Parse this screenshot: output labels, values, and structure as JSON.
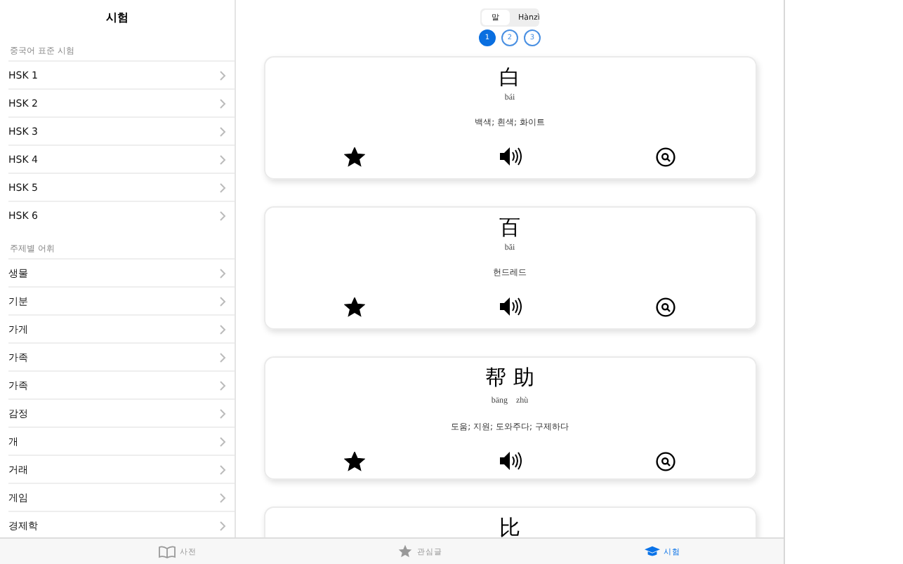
{
  "sidebar": {
    "title": "시험",
    "sections": [
      {
        "header": "중국어 표준 시험",
        "items": [
          {
            "label": "HSK 1"
          },
          {
            "label": "HSK 2"
          },
          {
            "label": "HSK 3"
          },
          {
            "label": "HSK 4"
          },
          {
            "label": "HSK 5"
          },
          {
            "label": "HSK 6"
          }
        ]
      },
      {
        "header": "주제별 어휘",
        "items": [
          {
            "label": "생물"
          },
          {
            "label": "기분"
          },
          {
            "label": "가게"
          },
          {
            "label": "가족"
          },
          {
            "label": "가족"
          },
          {
            "label": "감정"
          },
          {
            "label": "개"
          },
          {
            "label": "거래"
          },
          {
            "label": "게임"
          },
          {
            "label": "경제학"
          }
        ]
      }
    ]
  },
  "segmented": [
    {
      "label": "말",
      "selected": true
    },
    {
      "label": "Hànzì",
      "selected": false
    }
  ],
  "pages": [
    {
      "label": "1",
      "selected": true
    },
    {
      "label": "2",
      "selected": false
    },
    {
      "label": "3",
      "selected": false
    }
  ],
  "cards": [
    {
      "hanzi": "白",
      "pinyin": "bái",
      "meaning": "백색; 흰색; 화이트",
      "starred": true
    },
    {
      "hanzi": "百",
      "pinyin": "bǎi",
      "meaning": "헌드레드",
      "starred": true
    },
    {
      "hanzi": "帮 助",
      "pinyin": "bāng　zhù",
      "meaning": "도움; 지원; 도와주다; 구제하다",
      "starred": true
    },
    {
      "hanzi": "比"
    }
  ],
  "tab_bar": [
    {
      "label": "사전",
      "kind": "book",
      "selected": false
    },
    {
      "label": "관심글",
      "kind": "star",
      "selected": false
    },
    {
      "label": "시험",
      "kind": "cap",
      "selected": true
    }
  ]
}
